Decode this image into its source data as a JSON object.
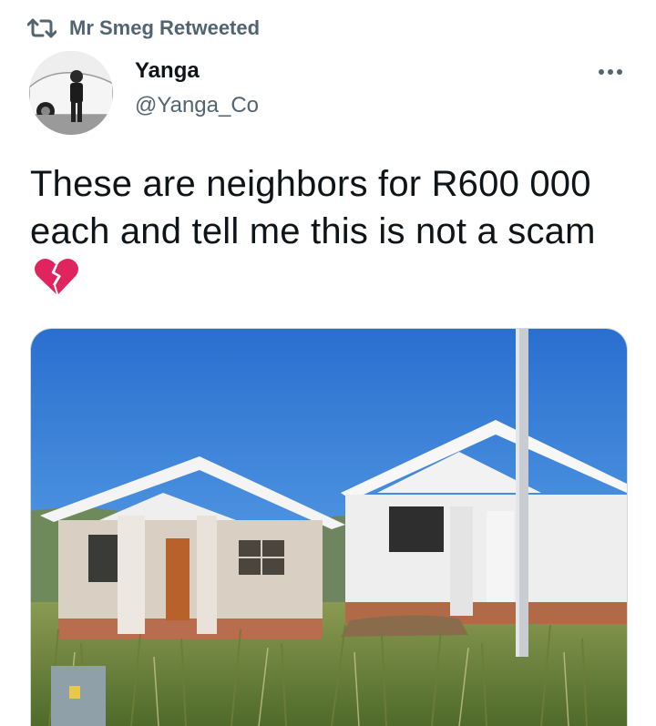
{
  "retweet": {
    "icon": "retweet-icon",
    "label": "Mr Smeg Retweeted"
  },
  "author": {
    "display_name": "Yanga",
    "handle": "@Yanga_Co",
    "avatar_icon": "avatar-photo"
  },
  "menu": {
    "icon": "more-horizontal-icon"
  },
  "tweet": {
    "text": "These are neighbors for R600 000 each and tell me this is not a scam",
    "emoji": "broken-heart-icon"
  },
  "media": {
    "kind": "photo",
    "subject": "two-houses-photo"
  },
  "colors": {
    "secondary_text": "#536471",
    "primary_text": "#0f1419",
    "heart": "#e0245e",
    "sky": "#2f7fd6"
  }
}
